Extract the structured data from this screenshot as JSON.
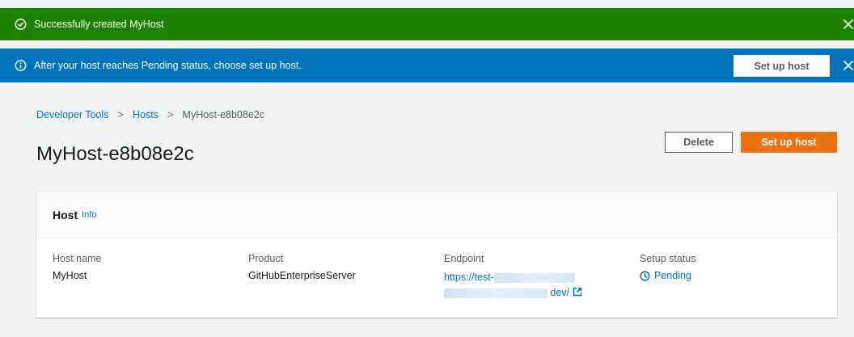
{
  "flash": {
    "success_message": "Successfully created MyHost",
    "info_message": "After your host reaches Pending status, choose set up host.",
    "info_button": "Set up host"
  },
  "breadcrumb": {
    "items": [
      "Developer Tools",
      "Hosts"
    ],
    "current": "MyHost-e8b08e2c",
    "separator": ">"
  },
  "page": {
    "title": "MyHost-e8b08e2c",
    "delete_label": "Delete",
    "setup_label": "Set up host"
  },
  "card": {
    "title": "Host",
    "info": "Info",
    "host_name_label": "Host name",
    "host_name": "MyHost",
    "product_label": "Product",
    "product": "GitHubEnterpriseServer",
    "endpoint_label": "Endpoint",
    "endpoint_part1": "https://test-",
    "endpoint_part2": "dev/",
    "status_label": "Setup status",
    "status": "Pending"
  },
  "colors": {
    "success": "#1d8102",
    "info": "#0073bb",
    "primary": "#ec7211",
    "link": "#0073bb"
  },
  "icons": {
    "success": "check-circle-icon",
    "info": "info-circle-icon",
    "close": "close-icon",
    "external": "external-link-icon",
    "pending": "clock-icon"
  }
}
